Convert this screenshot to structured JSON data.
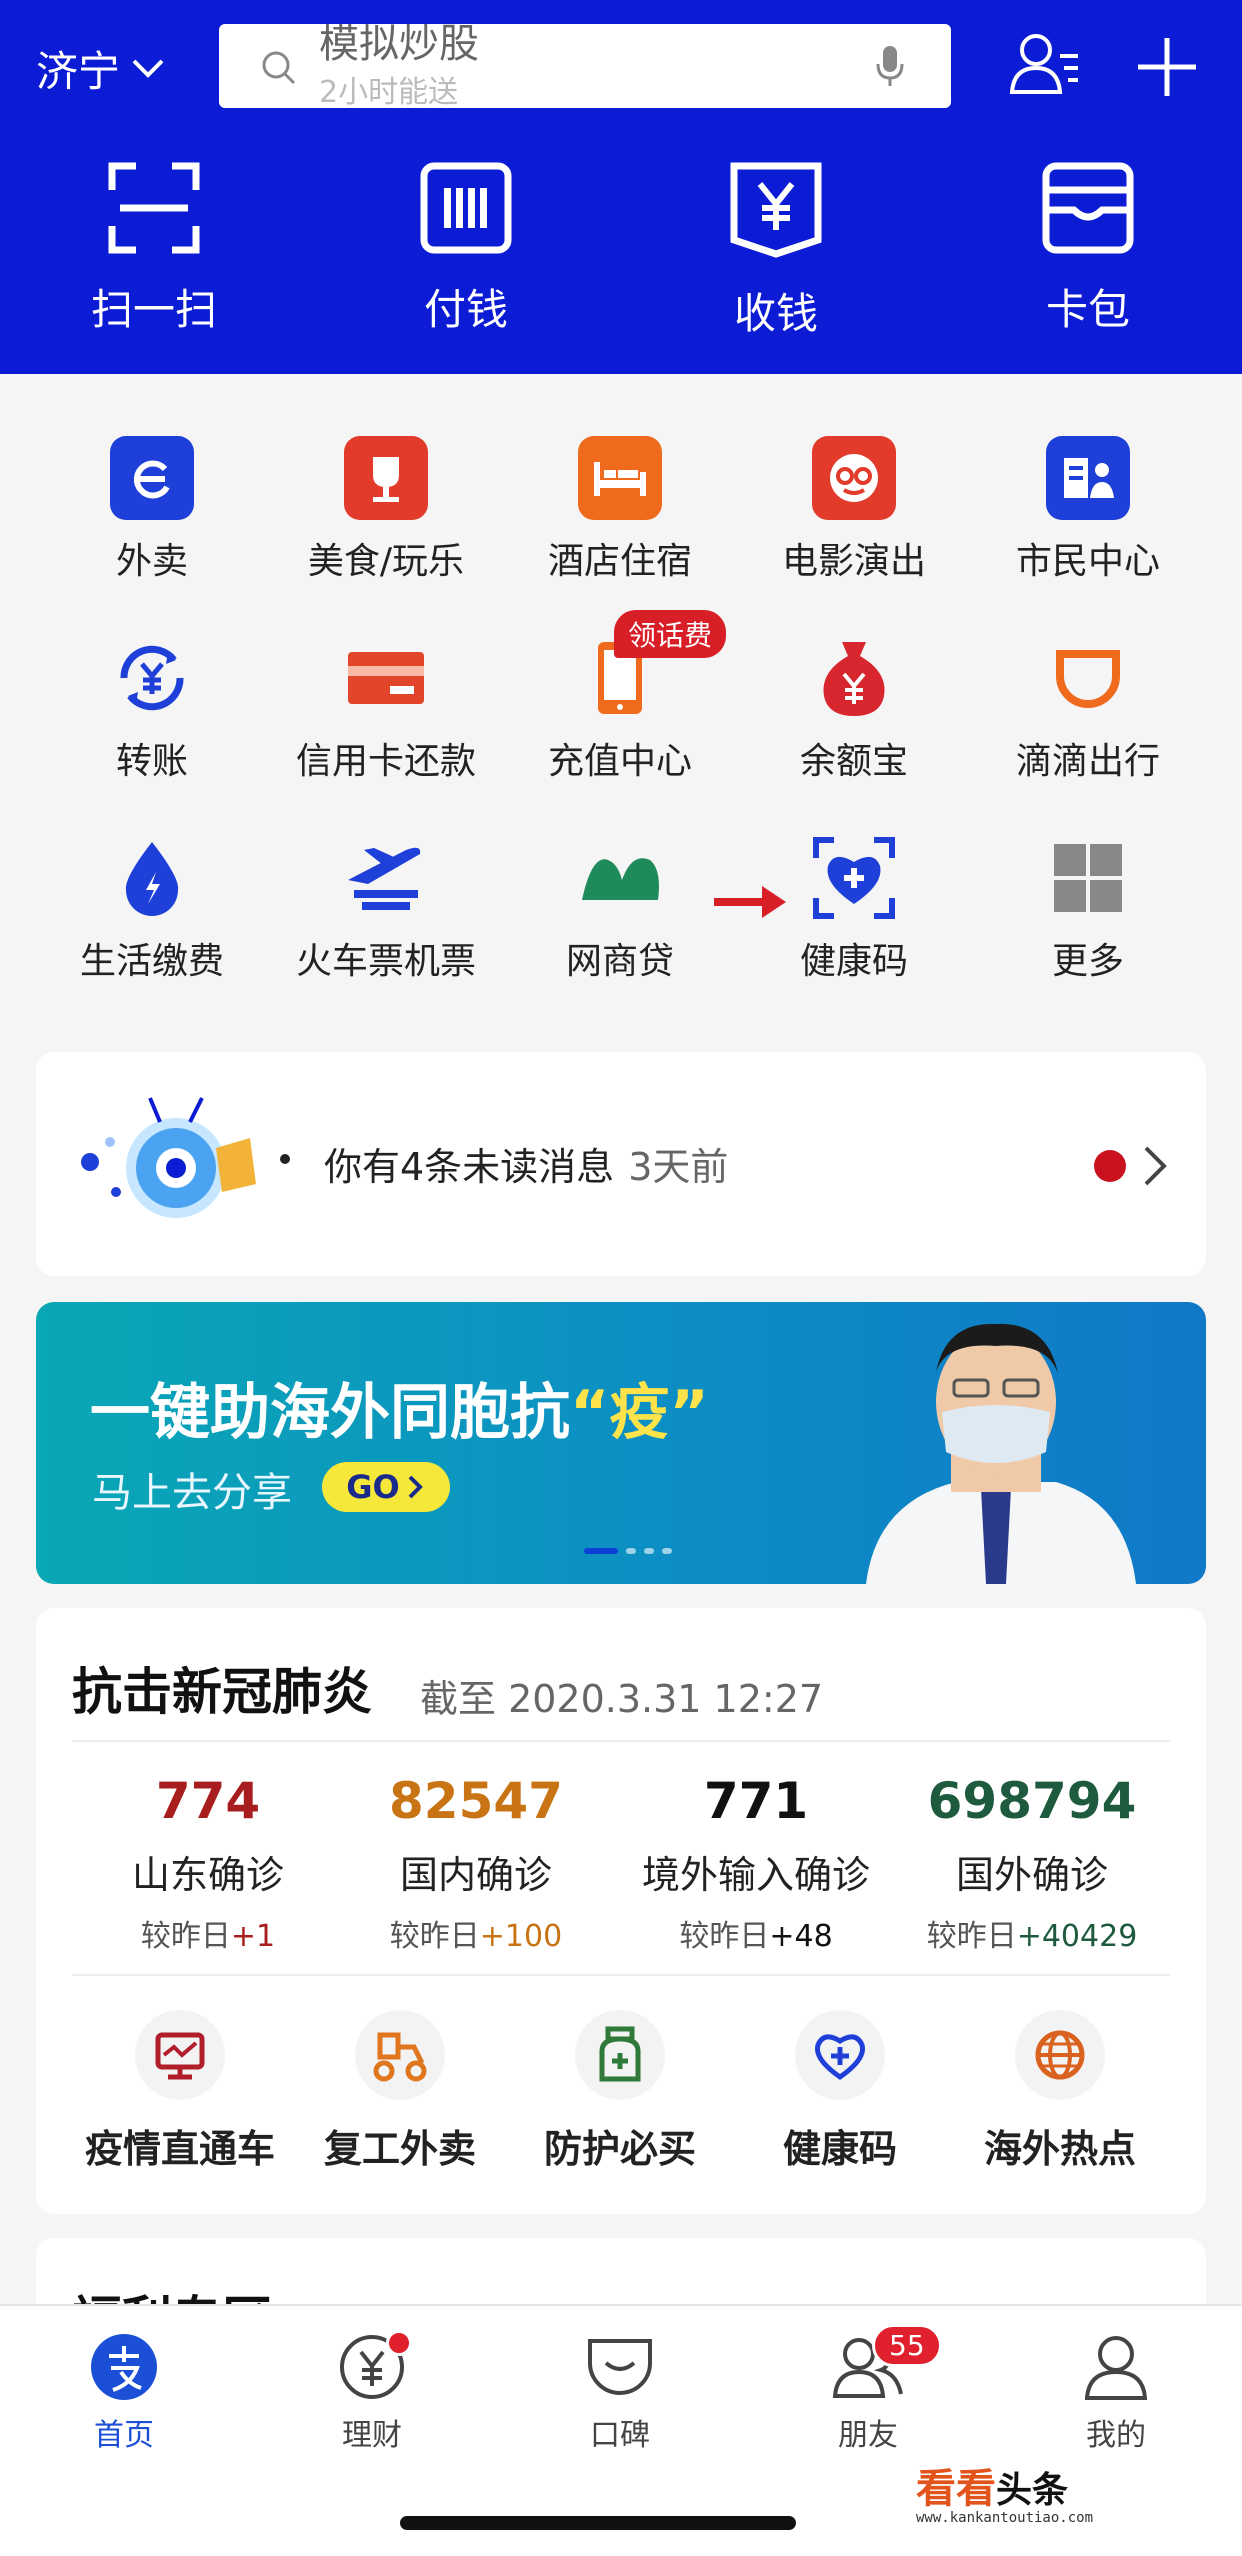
{
  "header": {
    "city": "济宁",
    "search_placeholder": "模拟炒股",
    "search_placeholder_next": "2小时能送",
    "quick_actions": [
      {
        "label": "扫一扫",
        "icon": "scan-icon"
      },
      {
        "label": "付钱",
        "icon": "barcode-icon"
      },
      {
        "label": "收钱",
        "icon": "receive-money-icon"
      },
      {
        "label": "卡包",
        "icon": "card-wallet-icon"
      }
    ]
  },
  "grid": {
    "items": [
      {
        "label": "外卖",
        "icon": "takeout-icon",
        "color": "#1e3fd8"
      },
      {
        "label": "美食/玩乐",
        "icon": "food-fun-icon",
        "color": "#e23a2b"
      },
      {
        "label": "酒店住宿",
        "icon": "hotel-icon",
        "color": "#f06a1e"
      },
      {
        "label": "电影演出",
        "icon": "movie-icon",
        "color": "#e23a2b"
      },
      {
        "label": "市民中心",
        "icon": "citizen-center-icon",
        "color": "#1e3fd8"
      },
      {
        "label": "转账",
        "icon": "transfer-icon",
        "color": "#1e3fd8"
      },
      {
        "label": "信用卡还款",
        "icon": "credit-card-icon",
        "color": "#e2462a"
      },
      {
        "label": "充值中心",
        "icon": "phone-recharge-icon",
        "color": "#f06a1e"
      },
      {
        "label": "余额宝",
        "icon": "yuebao-icon",
        "color": "#d8262e"
      },
      {
        "label": "滴滴出行",
        "icon": "didi-icon",
        "color": "#f06a1e"
      },
      {
        "label": "生活缴费",
        "icon": "utilities-icon",
        "color": "#1e3fd8"
      },
      {
        "label": "火车票机票",
        "icon": "train-plane-icon",
        "color": "#1e3fd8"
      },
      {
        "label": "网商贷",
        "icon": "mybank-loan-icon",
        "color": "#1f8a5a"
      },
      {
        "label": "健康码",
        "icon": "health-code-icon",
        "color": "#1e3fd8"
      },
      {
        "label": "更多",
        "icon": "more-grid-icon",
        "color": "#888888"
      }
    ],
    "recharge_badge": "领话费"
  },
  "message": {
    "text": "你有4条未读消息",
    "time": "3天前"
  },
  "banner": {
    "title_main": "一键助海外同胞抗",
    "title_highlight": "“疫”",
    "subtitle": "马上去分享",
    "go": "GO"
  },
  "covid": {
    "title": "抗击新冠肺炎",
    "as_of": "截至 2020.3.31 12:27",
    "stats": [
      {
        "num": "774",
        "label": "山东确诊",
        "delta_prefix": "较昨日",
        "delta": "+1",
        "color": "#a81e1e"
      },
      {
        "num": "82547",
        "label": "国内确诊",
        "delta_prefix": "较昨日",
        "delta": "+100",
        "color": "#c97414"
      },
      {
        "num": "771",
        "label": "境外输入确诊",
        "delta_prefix": "较昨日",
        "delta": "+48",
        "color": "#111111"
      },
      {
        "num": "698794",
        "label": "国外确诊",
        "delta_prefix": "较昨日",
        "delta": "+40429",
        "color": "#1d5a3e"
      }
    ],
    "shortcuts": [
      {
        "label": "疫情直通车",
        "icon": "epidemic-express-icon"
      },
      {
        "label": "复工外卖",
        "icon": "return-to-work-takeout-icon"
      },
      {
        "label": "防护必买",
        "icon": "protection-essentials-icon"
      },
      {
        "label": "健康码",
        "icon": "health-code-icon"
      },
      {
        "label": "海外热点",
        "icon": "globe-icon"
      }
    ]
  },
  "next_section": {
    "title": "福利专区"
  },
  "tabbar": {
    "tabs": [
      {
        "label": "首页",
        "icon": "alipay-home-icon",
        "active": true
      },
      {
        "label": "理财",
        "icon": "wealth-icon"
      },
      {
        "label": "口碑",
        "icon": "koubei-icon"
      },
      {
        "label": "朋友",
        "icon": "friends-icon",
        "badge": "55"
      },
      {
        "label": "我的",
        "icon": "profile-icon"
      }
    ]
  },
  "watermark": {
    "brand_a": "看看",
    "brand_b": "头条",
    "url": "www.kankantoutiao.com"
  }
}
